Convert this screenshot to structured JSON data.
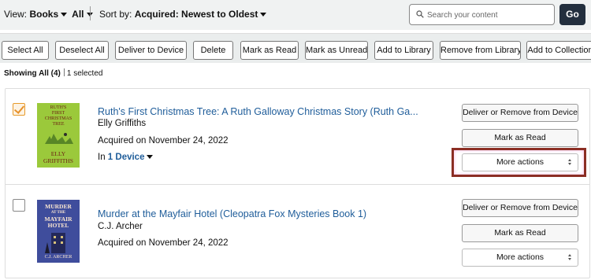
{
  "toolbar": {
    "view_prefix": "View:",
    "view_type": "Books",
    "view_filter": "All",
    "sort_prefix": "Sort by:",
    "sort_value": "Acquired: Newest to Oldest",
    "search_placeholder": "Search your content",
    "go_label": "Go"
  },
  "actions": [
    "Select All",
    "Deselect All",
    "Deliver to Device",
    "Delete",
    "Mark as Read",
    "Mark as Unread",
    "Add to Library",
    "Remove from Library",
    "Add to Collection"
  ],
  "status": {
    "showing": "Showing All (4)",
    "selected": "1 selected"
  },
  "items": [
    {
      "checked": true,
      "cover_lines": [
        "RUTH'S",
        "FIRST",
        "CHRISTMAS",
        "TREE",
        "ELLY",
        "GRIFFITHS"
      ],
      "title": "Ruth's First Christmas Tree: A Ruth Galloway Christmas Story (Ruth Ga...",
      "author": "Elly Griffiths",
      "acquired": "Acquired on November 24, 2022",
      "devices_prefix": "In",
      "devices_link": "1 Device",
      "btn_deliver": "Deliver or Remove from Device",
      "btn_read": "Mark as Read",
      "btn_more": "More actions"
    },
    {
      "checked": false,
      "cover_lines": [
        "MURDER",
        "AT THE",
        "MAYFAIR",
        "HOTEL",
        "C.J. ARCHER"
      ],
      "title": "Murder at the Mayfair Hotel (Cleopatra Fox Mysteries Book 1)",
      "author": "C.J. Archer",
      "acquired": "Acquired on November 24, 2022",
      "btn_deliver": "Deliver or Remove from Device",
      "btn_read": "Mark as Read",
      "btn_more": "More actions"
    }
  ],
  "colors": {
    "link": "#1f5d9a",
    "go_bg": "#232f3e",
    "highlight": "#8b2e24",
    "check": "#e7912b"
  }
}
